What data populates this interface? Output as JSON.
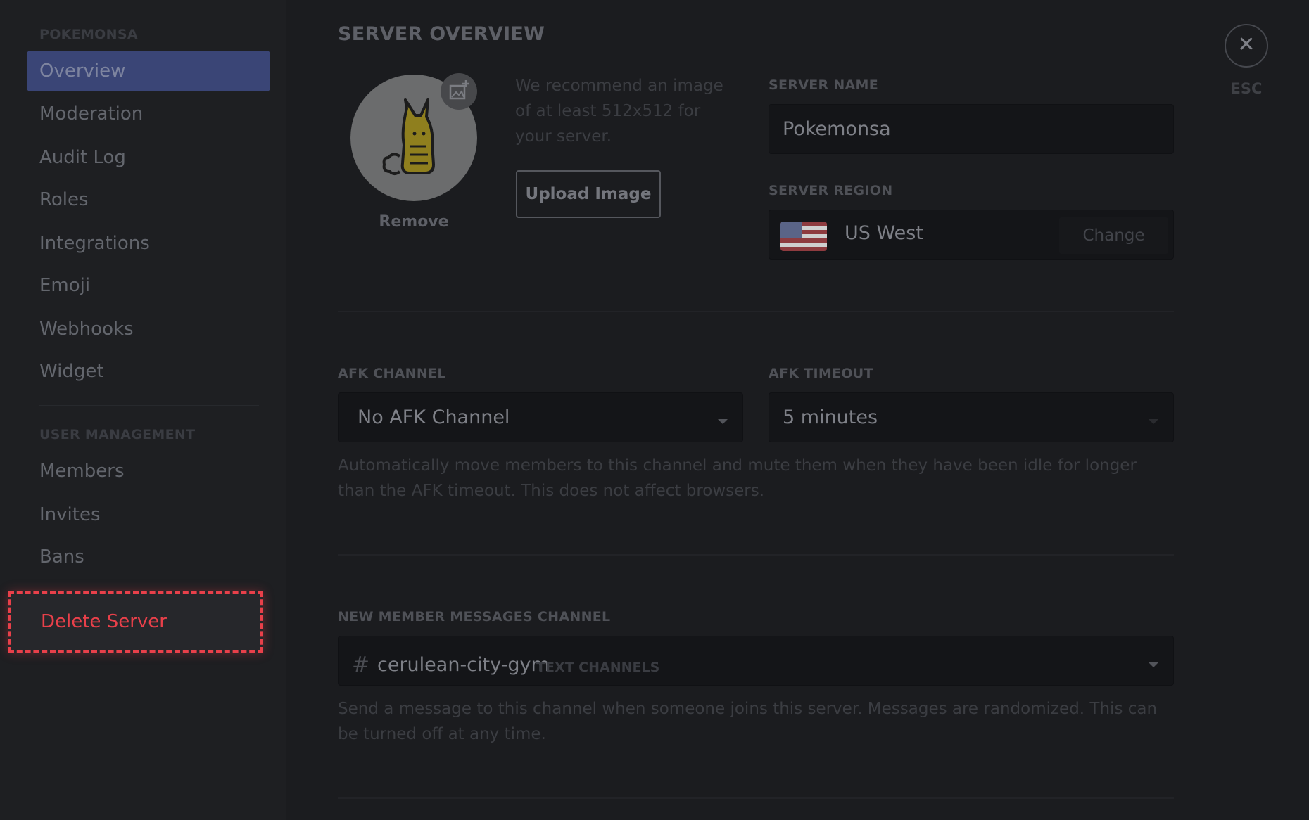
{
  "sidebar": {
    "server_label": "POKEMONSA",
    "items": [
      {
        "label": "Overview"
      },
      {
        "label": "Moderation"
      },
      {
        "label": "Audit Log"
      },
      {
        "label": "Roles"
      },
      {
        "label": "Integrations"
      },
      {
        "label": "Emoji"
      },
      {
        "label": "Webhooks"
      },
      {
        "label": "Widget"
      }
    ],
    "user_mgmt_label": "USER MANAGEMENT",
    "user_items": [
      {
        "label": "Members"
      },
      {
        "label": "Invites"
      },
      {
        "label": "Bans"
      }
    ],
    "delete_label": "Delete Server"
  },
  "main": {
    "title": "SERVER OVERVIEW",
    "icon": {
      "recommend_text": "We recommend an image of at least 512x512 for your server.",
      "upload_label": "Upload Image",
      "remove_label": "Remove"
    },
    "server_name": {
      "label": "SERVER NAME",
      "value": "Pokemonsa"
    },
    "server_region": {
      "label": "SERVER REGION",
      "value": "US West",
      "change_label": "Change"
    },
    "afk_channel": {
      "label": "AFK CHANNEL",
      "value": "No AFK Channel"
    },
    "afk_timeout": {
      "label": "AFK TIMEOUT",
      "value": "5 minutes"
    },
    "afk_help": "Automatically move members to this channel and mute them when they have been idle for longer than the AFK timeout. This does not affect browsers.",
    "new_member": {
      "label": "NEW MEMBER MESSAGES CHANNEL",
      "hash": "#",
      "channel": "cerulean-city-gym",
      "category": "TEXT CHANNELS"
    },
    "new_member_help": "Send a message to this channel when someone joins this server. Messages are randomized. This can be turned off at any time."
  },
  "close": {
    "esc_label": "ESC",
    "close_glyph": "✕"
  },
  "colors": {
    "accent": "#3a4576",
    "danger": "#e8404a",
    "background": "#1b1c1f"
  }
}
